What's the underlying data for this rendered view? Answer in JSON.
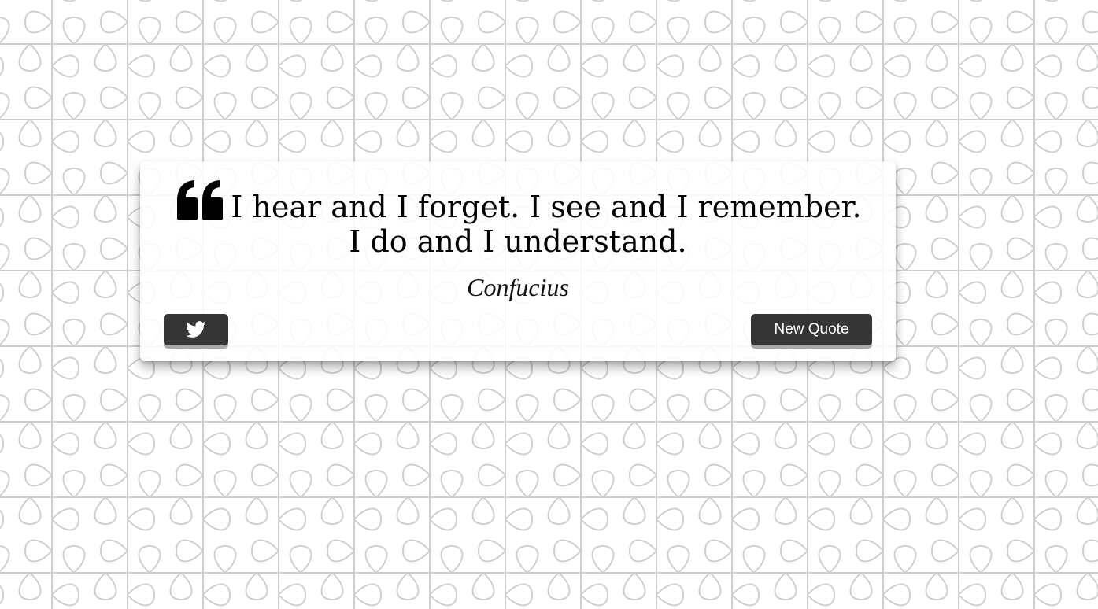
{
  "quote": {
    "text": "I hear and I forget. I see and I remember. I do and I understand.",
    "author": "Confucius"
  },
  "actions": {
    "tweet_icon": "twitter-icon",
    "new_quote_label": "New Quote"
  },
  "colors": {
    "button_bg": "#353535",
    "button_text": "#ffffff",
    "card_bg": "#ffffff",
    "pattern_stroke": "#cfcfcf"
  }
}
